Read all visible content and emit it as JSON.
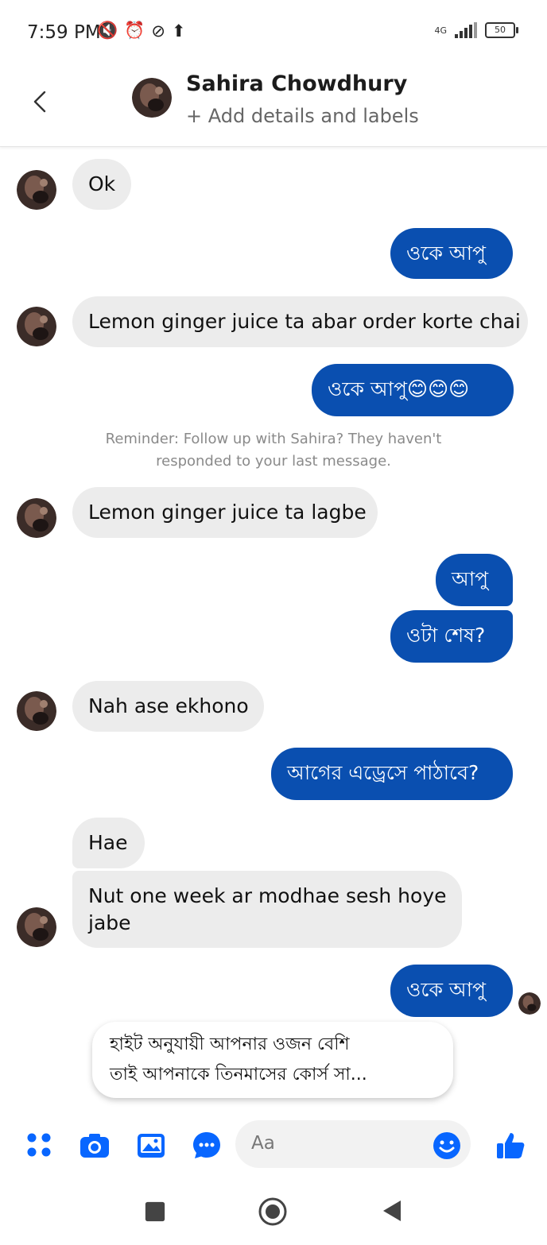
{
  "status_bar": {
    "time": "7:59 PM",
    "network": "4G",
    "battery": "50",
    "icons": [
      "mute-icon",
      "alarm-icon",
      "dnd-icon",
      "upload-icon"
    ]
  },
  "header": {
    "name": "Sahira Chowdhury",
    "subtitle": "+ Add details and labels"
  },
  "messages": [
    {
      "from": "contact",
      "text": "Ok"
    },
    {
      "from": "me",
      "text": "ওকে আপু"
    },
    {
      "from": "contact",
      "text": "Lemon ginger juice ta abar order korte chai"
    },
    {
      "from": "me",
      "text": "ওকে আপু😊😊😊"
    },
    {
      "from": "contact",
      "text": "Lemon ginger juice ta lagbe"
    },
    {
      "from": "me",
      "text": "আপু"
    },
    {
      "from": "me",
      "text": "ওটা শেষ?"
    },
    {
      "from": "contact",
      "text": "Nah ase ekhono"
    },
    {
      "from": "me",
      "text": "আগের এড্রেসে পাঠাবে?"
    },
    {
      "from": "contact",
      "text": "Hae"
    },
    {
      "from": "contact",
      "text": "Nut one week ar modhae sesh hoye jabe",
      "lines": [
        "Nut one week ar modhae sesh hoye",
        "jabe"
      ]
    },
    {
      "from": "me",
      "text": "ওকে আপু"
    }
  ],
  "reminder": {
    "line1": "Reminder: Follow up with Sahira? They haven't",
    "line2": "responded to your last message."
  },
  "suggestion": {
    "line1": "হাইট অনুযায়ী আপনার ওজন বেশি",
    "line2": "তাই আপনাকে তিনমাসের কোর্স সা..."
  },
  "composer": {
    "placeholder": "Aa",
    "icons": [
      "apps-icon",
      "camera-icon",
      "gallery-icon",
      "chat-extensions-icon",
      "emoji-icon",
      "like-icon"
    ],
    "accent": "#0866ff"
  },
  "colors": {
    "outgoing_bubble": "#0a4fb0",
    "incoming_bubble": "#ececec"
  }
}
